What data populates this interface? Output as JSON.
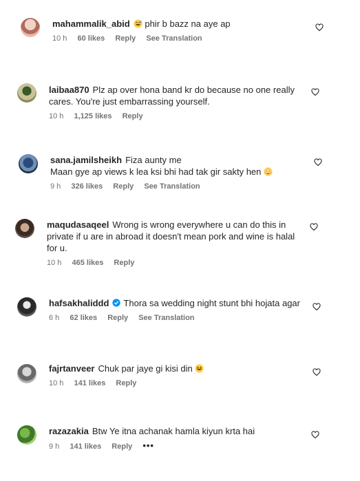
{
  "comments": [
    {
      "user": "mahammalik_abid",
      "text": "phir b bazz na aye ap",
      "emoji_before": "grinning-sweat-emoji",
      "time": "10 h",
      "likes": "60 likes",
      "reply": "Reply",
      "translation": "See Translation"
    },
    {
      "user": "laibaa870",
      "text_line1": "Plz ap over hona band kr do because no one really",
      "text_line2": "cares. You're just embarrassing yourself.",
      "time": "10 h",
      "likes": "1,125 likes",
      "reply": "Reply"
    },
    {
      "user": "sana.jamilsheikh",
      "text_line1": "Fiza aunty me",
      "text_line2": "Maan gye ap views k lea ksi bhi had tak gir sakty hen",
      "emoji_after": "flushed-emoji",
      "time": "9 h",
      "likes": "326 likes",
      "reply": "Reply",
      "translation": "See Translation"
    },
    {
      "user": "maqudasaqeel",
      "text_line1": "Wrong is wrong everywhere u can do this in",
      "text_line2": "private if u are in abroad it doesn't mean pork and wine is halal",
      "text_line3": "for u.",
      "time": "10 h",
      "likes": "465 likes",
      "reply": "Reply"
    },
    {
      "user": "hafsakhaliddd",
      "text": "Thora sa wedding night stunt bhi hojata agar",
      "verified": true,
      "time": "6 h",
      "likes": "62 likes",
      "reply": "Reply",
      "translation": "See Translation"
    },
    {
      "user": "fajrtanveer",
      "text": "Chuk par jaye gi kisi din",
      "emoji_after": "laughing-emoji",
      "time": "10 h",
      "likes": "141 likes",
      "reply": "Reply"
    },
    {
      "user": "razazakia",
      "text": "Btw Ye itna achanak hamla kiyun krta hai",
      "time": "9 h",
      "likes": "141 likes",
      "reply": "Reply",
      "more": "•••"
    }
  ],
  "colors": {
    "text": "#262626",
    "meta": "#737373",
    "verified": "#0095f6"
  }
}
